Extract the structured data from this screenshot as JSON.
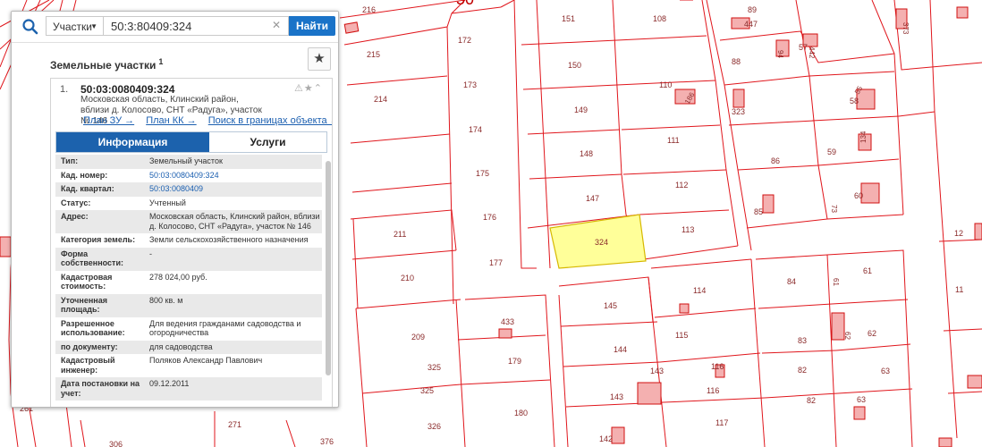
{
  "search": {
    "type_label": "Участки",
    "query": "50:3:80409:324",
    "find_label": "Найти"
  },
  "results": {
    "title": "Земельные участки",
    "count": "1"
  },
  "item": {
    "number": "1.",
    "cad_number": "50:03:0080409:324",
    "address": "Московская область, Клинский район, вблизи д. Колосово, СНТ «Радуга», участок № 146",
    "links": [
      "План ЗУ →",
      "План КК →",
      "Поиск в границах объекта →"
    ],
    "tabs": [
      "Информация",
      "Услуги"
    ],
    "fields": [
      {
        "k": "Тип:",
        "v": "Земельный участок"
      },
      {
        "k": "Кад. номер:",
        "v": "50:03:0080409:324"
      },
      {
        "k": "Кад. квартал:",
        "v": "50:03:0080409"
      },
      {
        "k": "Статус:",
        "v": "Учтенный"
      },
      {
        "k": "Адрес:",
        "v": "Московская область, Клинский район, вблизи д. Колосово, СНТ «Радуга», участок № 146"
      },
      {
        "k": "Категория земель:",
        "v": "Земли сельскохозяйственного назначения"
      },
      {
        "k": "Форма собственности:",
        "v": "-"
      },
      {
        "k": "Кадастровая стоимость:",
        "v": "278 024,00 руб."
      },
      {
        "k": "Уточненная площадь:",
        "v": "800 кв. м"
      },
      {
        "k": "Разрешенное использование:",
        "v": "Для ведения гражданами садоводства и огородничества"
      },
      {
        "k": "по документу:",
        "v": "для садоводства"
      },
      {
        "k": "Кадастровый инженер:",
        "v": "Поляков Александр Павлович"
      },
      {
        "k": "Дата постановки на учет:",
        "v": "09.12.2011"
      }
    ]
  },
  "map": {
    "block_label": "50",
    "highlight_color": "#ffff99",
    "boundary_color": "#e0161c",
    "parcel_labels": [
      "216",
      "151",
      "108",
      "89",
      "447",
      "57",
      "373",
      "172",
      "215",
      "150",
      "88",
      "94",
      "442",
      "214",
      "173",
      "110",
      "186",
      "323",
      "58",
      "55",
      "149",
      "174",
      "148",
      "111",
      "86",
      "59",
      "134",
      "175",
      "147",
      "112",
      "85",
      "60",
      "73",
      "176",
      "211",
      "324",
      "113",
      "12",
      "177",
      "210",
      "84",
      "61",
      "61",
      "114",
      "11",
      "145",
      "209",
      "433",
      "115",
      "83",
      "62",
      "62",
      "325",
      "179",
      "144",
      "143",
      "116",
      "82",
      "262",
      "325",
      "143",
      "116",
      "82",
      "63",
      "261",
      "180",
      "271",
      "326",
      "117",
      "142",
      "306",
      "376",
      "63"
    ]
  },
  "colors": {
    "accent": "#1c62ad",
    "find_button": "#1a73c8",
    "link": "#1b5fb0"
  }
}
